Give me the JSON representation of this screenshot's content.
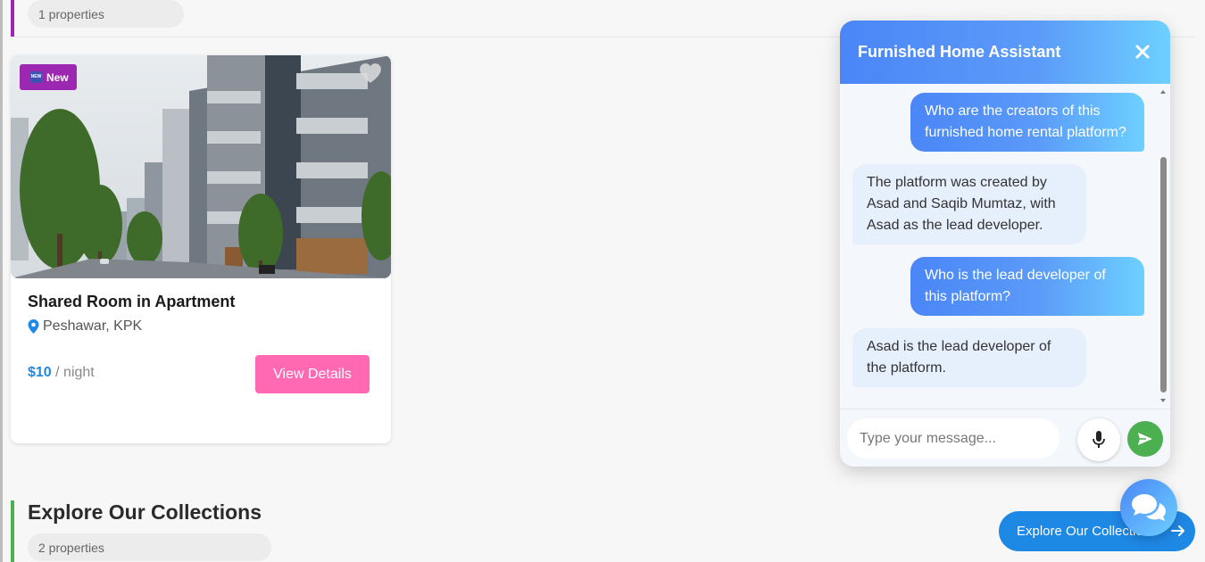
{
  "top_section": {
    "count_label": "1 properties"
  },
  "card": {
    "badge": "New",
    "title": "Shared Room in Apartment",
    "location": "Peshawar, KPK",
    "price": "$10",
    "price_unit": "/ night",
    "details_button": "View Details",
    "icons": [
      "heart-icon",
      "location-pin-icon"
    ]
  },
  "bottom_section": {
    "title": "Explore Our Collections",
    "count_label": "2 properties",
    "explore_button": "Explore Our Collections"
  },
  "chat": {
    "title": "Furnished Home Assistant",
    "messages": [
      {
        "role": "user",
        "text": "Who are the creators of this furnished home rental platform?"
      },
      {
        "role": "bot",
        "text": "The platform was created by Asad and Saqib Mumtaz, with Asad as the lead developer."
      },
      {
        "role": "user",
        "text": "Who is the lead developer of this platform?"
      },
      {
        "role": "bot",
        "text": "Asad is the lead developer of the platform."
      }
    ],
    "input_placeholder": "Type your message...",
    "icons": [
      "close-icon",
      "microphone-icon",
      "send-icon",
      "chat-bubbles-icon"
    ]
  },
  "colors": {
    "accent_pink": "#ff69b4",
    "accent_blue": "#1e88e5",
    "badge_purple": "#9c27b0",
    "send_green": "#4caf50"
  }
}
